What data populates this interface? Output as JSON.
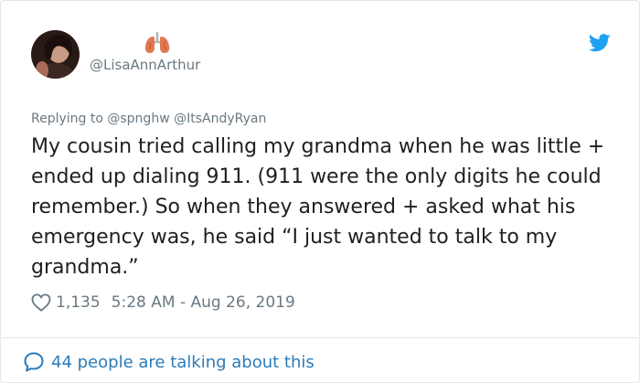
{
  "tweet": {
    "handle": "@LisaAnnArthur",
    "replying_to": "Replying to @spnghw @ItsAndyRyan",
    "text": "My cousin tried calling my grandma when he was little + ended up dialing 911. (911 were the only digits he could remember.) So when they answered + asked what his emergency was, he said “I just wanted to talk to my grandma.”",
    "likes": "1,135",
    "timestamp": "5:28 AM - Aug 26, 2019",
    "conversation": "44 people are talking about this"
  },
  "icons": {
    "display_name": "lungs-emoji",
    "logo": "twitter-bird-icon",
    "like": "heart-icon",
    "reply": "speech-bubble-icon"
  },
  "colors": {
    "twitter_blue": "#1da1f2",
    "link_blue": "#2b7bb9",
    "muted_text": "#697882",
    "body_text": "#1c2022",
    "lungs": "#e07850"
  }
}
